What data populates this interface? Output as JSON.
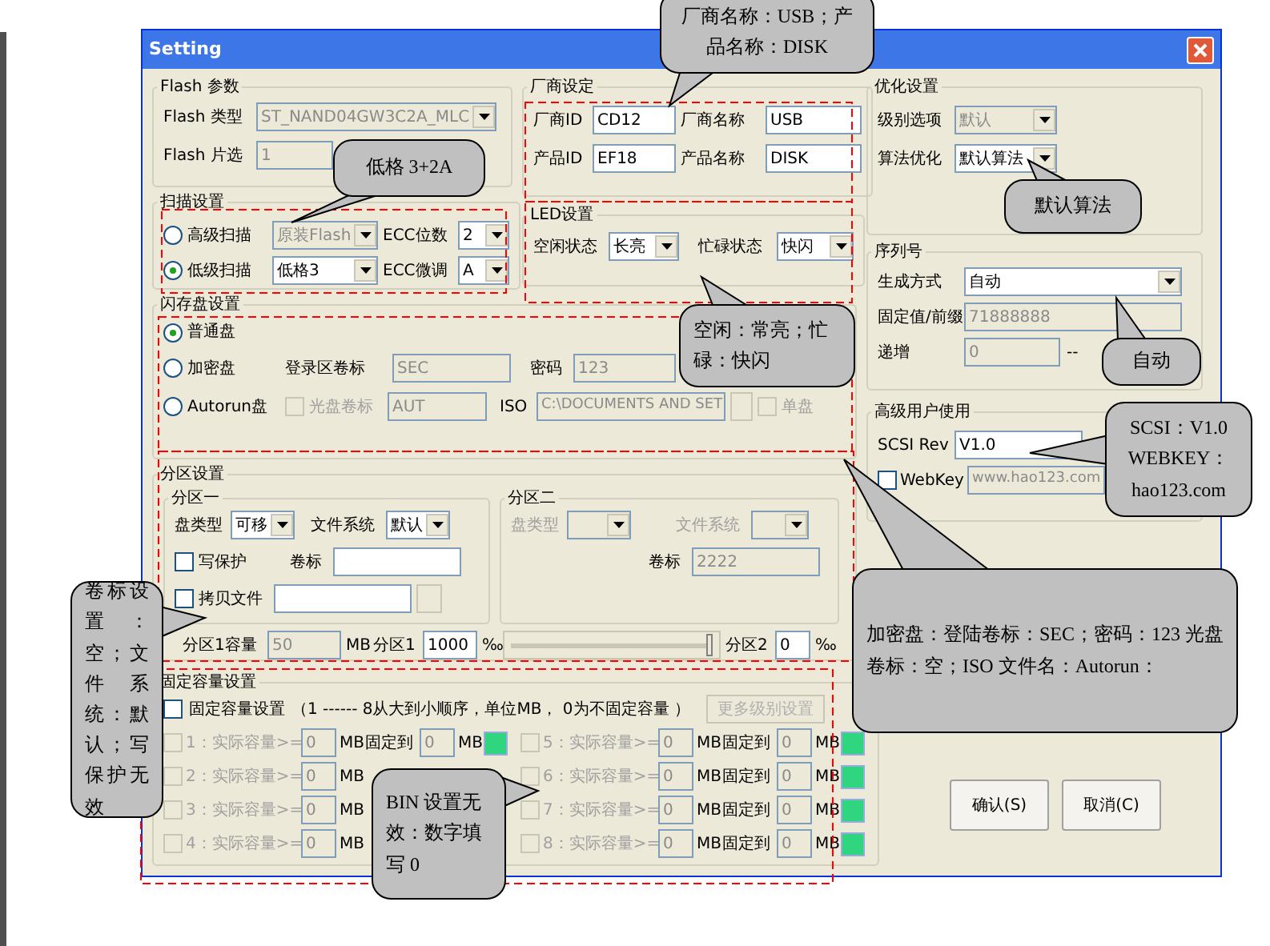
{
  "window": {
    "title": "Setting"
  },
  "flash_params": {
    "title": "Flash 参数",
    "type": {
      "label": "Flash 类型",
      "value": "ST_NAND04GW3C2A_MLC",
      "disabled": true
    },
    "chip": {
      "label": "Flash 片选",
      "value": "1",
      "disabled": true
    }
  },
  "scan": {
    "title": "扫描设置",
    "modes": [
      {
        "label": "高级扫描",
        "selected": false,
        "value": "原装Flash",
        "disabled": true
      },
      {
        "label": "低级扫描",
        "selected": true,
        "value": "低格3",
        "disabled": false
      }
    ],
    "ecc_bits": {
      "label": "ECC位数",
      "value": "2"
    },
    "ecc_tune": {
      "label": "ECC微调",
      "value": "A"
    }
  },
  "vendor": {
    "title": "厂商设定",
    "fields": [
      {
        "label": "厂商ID",
        "value": "CD12"
      },
      {
        "label": "厂商名称",
        "value": "USB"
      },
      {
        "label": "产品ID",
        "value": "EF18"
      },
      {
        "label": "产品名称",
        "value": "DISK"
      }
    ]
  },
  "led": {
    "title": "LED设置",
    "idle": {
      "label": "空闲状态",
      "value": "长亮"
    },
    "busy": {
      "label": "忙碌状态",
      "value": "快闪"
    }
  },
  "disk": {
    "title": "闪存盘设置",
    "modes": [
      {
        "label": "普通盘",
        "selected": true
      },
      {
        "label": "加密盘",
        "selected": false
      },
      {
        "label": "Autorun盘",
        "selected": false
      }
    ],
    "login": {
      "label": "登录区卷标",
      "value": "SEC",
      "disabled": true
    },
    "password": {
      "label": "密码",
      "value": "123",
      "disabled": true
    },
    "cd": {
      "label": "光盘卷标",
      "checked": false,
      "value": "AUT",
      "disabled": true
    },
    "iso": {
      "label": "ISO",
      "value": "C:\\DOCUMENTS AND SET",
      "disabled": true
    },
    "single": {
      "label": "单盘",
      "checked": false
    }
  },
  "optimize": {
    "title": "优化设置",
    "level": {
      "label": "级别选项",
      "value": "默认",
      "disabled": true
    },
    "algo": {
      "label": "算法优化",
      "value": "默认算法",
      "disabled": false
    }
  },
  "serial": {
    "title": "序列号",
    "mode": {
      "label": "生成方式",
      "value": "自动",
      "disabled": false
    },
    "fixed": {
      "label": "固定值/前缀",
      "value": "71888888",
      "disabled": true
    },
    "inc": {
      "label": "递增",
      "value": "0",
      "disabled": true,
      "separator": "--"
    }
  },
  "advanced": {
    "title": "高级用户使用",
    "scsi": {
      "label": "SCSI Rev",
      "value": "V1.0",
      "disabled": false
    },
    "webkey": {
      "label": "WebKey",
      "checked": false,
      "value": "www.hao123.com",
      "disabled": true
    }
  },
  "partition": {
    "title": "分区设置",
    "p1": {
      "title": "分区一",
      "type": {
        "label": "盘类型",
        "value": "可移"
      },
      "fs": {
        "label": "文件系统",
        "value": "默认"
      },
      "protect": {
        "label": "写保护",
        "checked": false
      },
      "volume": {
        "label": "卷标"
      },
      "copy": {
        "label": "拷贝文件",
        "checked": false
      }
    },
    "p2": {
      "title": "分区二",
      "type": {
        "label": "盘类型"
      },
      "fs": {
        "label": "文件系统"
      },
      "volume": {
        "label": "卷标",
        "value": "2222",
        "disabled": true
      }
    },
    "size": {
      "label": "分区1容量",
      "value": "50",
      "unit": "MB",
      "disabled": true
    },
    "share1": {
      "label": "分区1",
      "value": "1000",
      "unit": "‰"
    },
    "slider": {
      "level": 1
    },
    "share2": {
      "label": "分区2",
      "value": "0",
      "unit": "‰"
    }
  },
  "fixed_capacity": {
    "title": "固定容量设置",
    "enable": {
      "label": "固定容量设置",
      "checked": false
    },
    "hint": "（1 ------ 8从大到小顺序，单位MB， 0为不固定容量 ）",
    "more_button": {
      "label": "更多级别设置",
      "disabled": true
    },
    "rows": [
      {
        "label": "1：实际容量>=",
        "value": "0",
        "unit": "MB",
        "fixed_label": "固定到",
        "fixed_value": "0",
        "fixed_unit": "MB",
        "checked": false,
        "disabled": true
      },
      {
        "label": "2：实际容量>=",
        "value": "0",
        "unit": "MB",
        "checked": false,
        "disabled": true
      },
      {
        "label": "3：实际容量>=",
        "value": "0",
        "unit": "MB",
        "checked": false,
        "disabled": true
      },
      {
        "label": "4：实际容量>=",
        "value": "0",
        "unit": "MB",
        "checked": false,
        "disabled": true
      },
      {
        "label": "5：实际容量>=",
        "value": "0",
        "unit": "MB",
        "fixed_label": "固定到",
        "fixed_value": "0",
        "fixed_unit": "MB",
        "checked": false,
        "disabled": true
      },
      {
        "label": "6：实际容量>=",
        "value": "0",
        "unit": "MB",
        "fixed_label": "固定到",
        "fixed_value": "0",
        "fixed_unit": "MB",
        "checked": false,
        "disabled": true
      },
      {
        "label": "7：实际容量>=",
        "value": "0",
        "unit": "MB",
        "fixed_label": "固定到",
        "fixed_value": "0",
        "fixed_unit": "MB",
        "checked": false,
        "disabled": true
      },
      {
        "label": "8：实际容量>=",
        "value": "0",
        "unit": "MB",
        "fixed_label": "固定到",
        "fixed_value": "0",
        "fixed_unit": "MB",
        "checked": false,
        "disabled": true
      }
    ]
  },
  "buttons": [
    "确认(S)",
    "取消(C)"
  ],
  "callouts": [
    {
      "text": "厂商名称：USB；产品名称：DISK"
    },
    {
      "text": "低格 3+2A"
    },
    {
      "text": "空闲：常亮；忙碌：快闪"
    },
    {
      "text": "默认算法"
    },
    {
      "text": "自动"
    },
    {
      "text": "SCSI：V1.0 WEBKEY：hao123.com"
    },
    {
      "text": "加密盘：登陆卷标：SEC；密码：123 光盘卷标：空；ISO 文件名：Autorun："
    },
    {
      "text": "卷标设置：空；文件系统：默认；写保护无效"
    },
    {
      "text": "BIN 设置无效：数字填写 0"
    }
  ]
}
